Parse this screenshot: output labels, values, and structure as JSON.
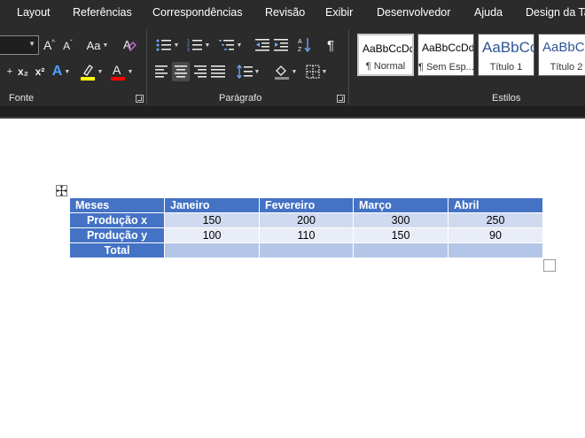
{
  "menu": {
    "tabs": [
      "Layout",
      "Referências",
      "Correspondências",
      "Revisão",
      "Exibir",
      "Desenvolvedor",
      "Ajuda",
      "Design da Ta"
    ]
  },
  "ribbon": {
    "groups": {
      "font_label": "Fonte",
      "paragraph_label": "Parágrafo",
      "styles_label": "Estilos"
    },
    "font_buttons": {
      "grow": "A^",
      "shrink": "Aˇ",
      "change_case": "Aa",
      "subscript": "x₂",
      "superscript": "x²",
      "text_effects": "A",
      "font_color": "A"
    },
    "paragraph_buttons": {
      "sort": "A↓Z",
      "show_marks": "¶"
    },
    "styles": [
      {
        "sample": "AaBbCcDd",
        "name": "¶ Normal",
        "selected": true
      },
      {
        "sample": "AaBbCcDd",
        "name": "¶ Sem Esp...",
        "selected": false
      },
      {
        "sample": "AaBbCc",
        "name": "Título 1",
        "selected": false
      },
      {
        "sample": "AaBbCc",
        "name": "Título 2",
        "selected": false
      }
    ]
  },
  "colors": {
    "ribbon_bg": "#2b2b2b",
    "table_header": "#4472c4",
    "highlight_yellow": "#ffff00",
    "font_red": "#ff0000"
  },
  "table": {
    "headers": [
      "Meses",
      "Janeiro",
      "Fevereiro",
      "Março",
      "Abril"
    ],
    "rows": [
      {
        "label": "Produção x",
        "values": [
          "150",
          "200",
          "300",
          "250"
        ]
      },
      {
        "label": "Produção y",
        "values": [
          "100",
          "110",
          "150",
          "90"
        ]
      },
      {
        "label": "Total",
        "values": [
          "",
          "",
          "",
          ""
        ]
      }
    ]
  }
}
